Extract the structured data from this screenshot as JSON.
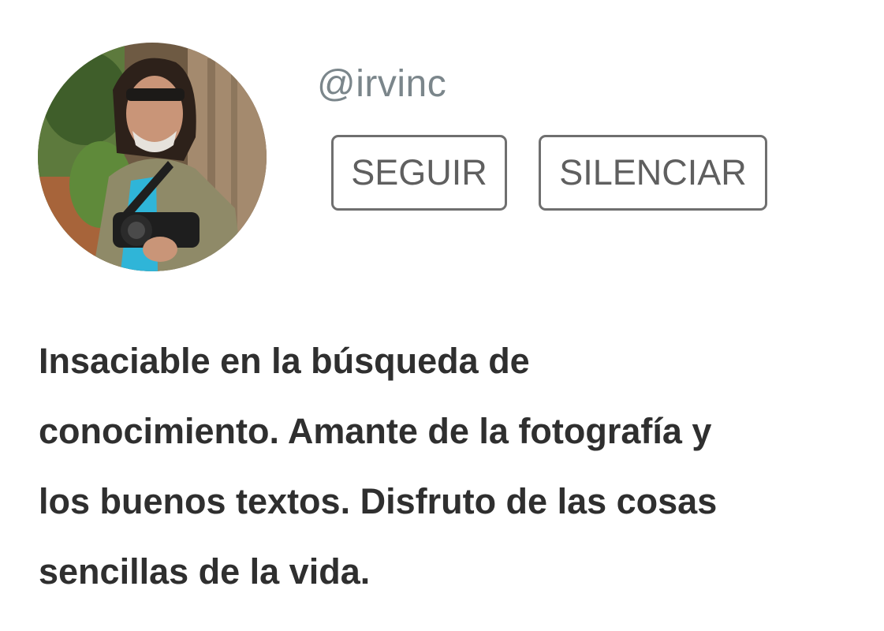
{
  "profile": {
    "username": "@irvinc",
    "avatar_icon": "user-avatar-photo",
    "follow_label": "SEGUIR",
    "mute_label": "SILENCIAR",
    "bio_lines": [
      "Insaciable en la búsqueda de",
      "conocimiento. Amante de la fotografía y",
      "los buenos textos. Disfruto de las cosas",
      "sencillas de la vida."
    ]
  },
  "colors": {
    "username": "#7b868b",
    "button_border": "#6f6f6f",
    "button_text": "#5f5f5f",
    "bio_text": "#2f2f2f",
    "background": "#ffffff"
  }
}
